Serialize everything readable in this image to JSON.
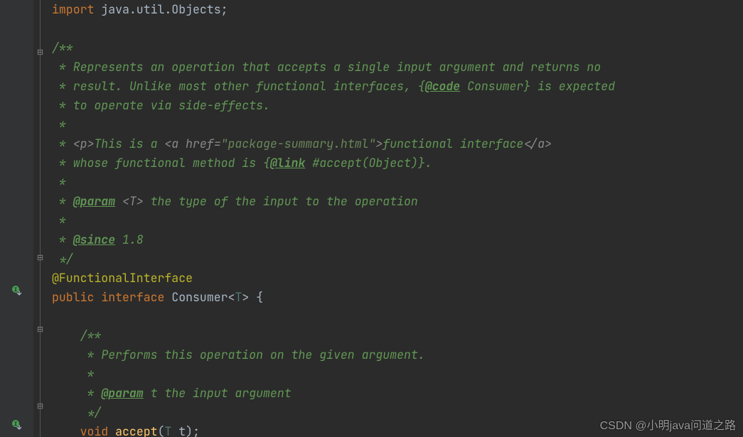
{
  "code": {
    "import_kw": "import",
    "import_pkg": " java.util.Objects",
    "semicolon": ";",
    "doc_open": "/**",
    "star": " * ",
    "star_only": " *",
    "d1a": "Represents an operation that accepts a single input argument and returns no",
    "d2a": "result. Unlike most other functional interfaces, {",
    "d2_tag": "@code",
    "d2b": " Consumer} is expected",
    "d3": "to operate via side-effects.",
    "d5_a": "<p>",
    "d5_b": "This is a ",
    "d5_open": "<a ",
    "d5_attr": "href=",
    "d5_href": "\"package-summary.html\"",
    "d5_close": ">",
    "d5_text": "functional interface",
    "d5_enda": "</a>",
    "d6_a": "whose functional method is {",
    "d6_tag": "@link",
    "d6_b": " #accept(Object)",
    "d6_c": "}.",
    "param_tag": "@param",
    "param_type": " <T> ",
    "param_desc": "the type of the input to the operation",
    "since_tag": "@since",
    "since_val": " 1.8",
    "doc_close": " */",
    "annotation": "@FunctionalInterface",
    "public": "public",
    "interface": "interface",
    "cls_name": "Consumer",
    "generic_open": "<",
    "generic_t": "T",
    "generic_close": ">",
    "brace_open": " {",
    "indent4": "    ",
    "mdoc1": "Performs this operation on the given argument.",
    "mparam_tag": "@param",
    "mparam_name": " t ",
    "mparam_desc": "the input argument",
    "void": "void",
    "accept": "accept",
    "paren_open": "(",
    "param_type_T": "T",
    "param_name": " t",
    "paren_close": ")",
    "watermark": "CSDN @小明java问道之路"
  },
  "fold": {
    "minus": "⊟",
    "end": "⊟"
  }
}
